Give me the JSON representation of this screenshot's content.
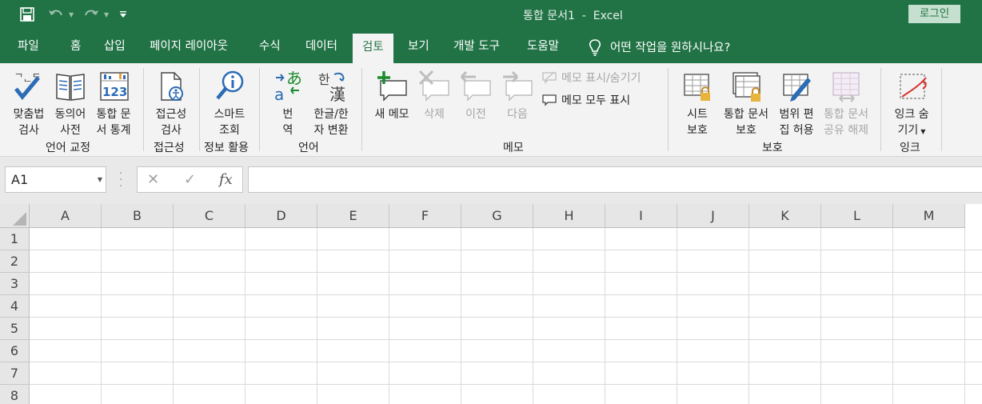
{
  "window": {
    "title": "통합 문서1  -  Excel",
    "login_label": "로그인"
  },
  "tabs": [
    {
      "label": "파일"
    },
    {
      "label": "홈"
    },
    {
      "label": "삽입"
    },
    {
      "label": "페이지 레이아웃"
    },
    {
      "label": "수식"
    },
    {
      "label": "데이터"
    },
    {
      "label": "검토",
      "active": true
    },
    {
      "label": "보기"
    },
    {
      "label": "개발 도구"
    },
    {
      "label": "도움말"
    }
  ],
  "tell_me": "어떤 작업을 원하시나요?",
  "ribbon": {
    "proofing": {
      "group_label": "언어 교정",
      "spelling": [
        "맞춤법",
        "검사"
      ],
      "thesaurus": [
        "동의어",
        "사전"
      ],
      "workbook_stats": [
        "통합 문",
        "서 통계"
      ]
    },
    "accessibility": {
      "group_label": "접근성",
      "check": [
        "접근성",
        "검사"
      ]
    },
    "insights": {
      "group_label": "정보 활용",
      "smart_lookup": [
        "스마트",
        "조회"
      ]
    },
    "language": {
      "group_label": "언어",
      "translate": [
        "번",
        "역"
      ],
      "hangul_hanja": [
        "한글/한",
        "자 변환"
      ]
    },
    "comments": {
      "group_label": "메모",
      "new": "새 메모",
      "delete": "삭제",
      "previous": "이전",
      "next": "다음",
      "show_hide": "메모 표시/숨기기",
      "show_all": "메모 모두 표시"
    },
    "protect": {
      "group_label": "보호",
      "protect_sheet": [
        "시트",
        "보호"
      ],
      "protect_workbook": [
        "통합 문서",
        "보호"
      ],
      "allow_edit_ranges": [
        "범위 편",
        "집 허용"
      ],
      "unshare_workbook": [
        "통합 문서",
        "공유 해제"
      ]
    },
    "ink": {
      "group_label": "잉크",
      "hide_ink": [
        "잉크 숨",
        "기기"
      ]
    }
  },
  "formula_bar": {
    "name_box": "A1",
    "fx": "fx",
    "cancel": "✕",
    "enter": "✓",
    "value": ""
  },
  "grid": {
    "columns": [
      "A",
      "B",
      "C",
      "D",
      "E",
      "F",
      "G",
      "H",
      "I",
      "J",
      "K",
      "L",
      "M"
    ],
    "rows": [
      "1",
      "2",
      "3",
      "4",
      "5",
      "6",
      "7",
      "8"
    ]
  },
  "colors": {
    "accent": "#217346",
    "ribbon_bg": "#f3f3f3",
    "header_bg": "#e6e6e6"
  }
}
